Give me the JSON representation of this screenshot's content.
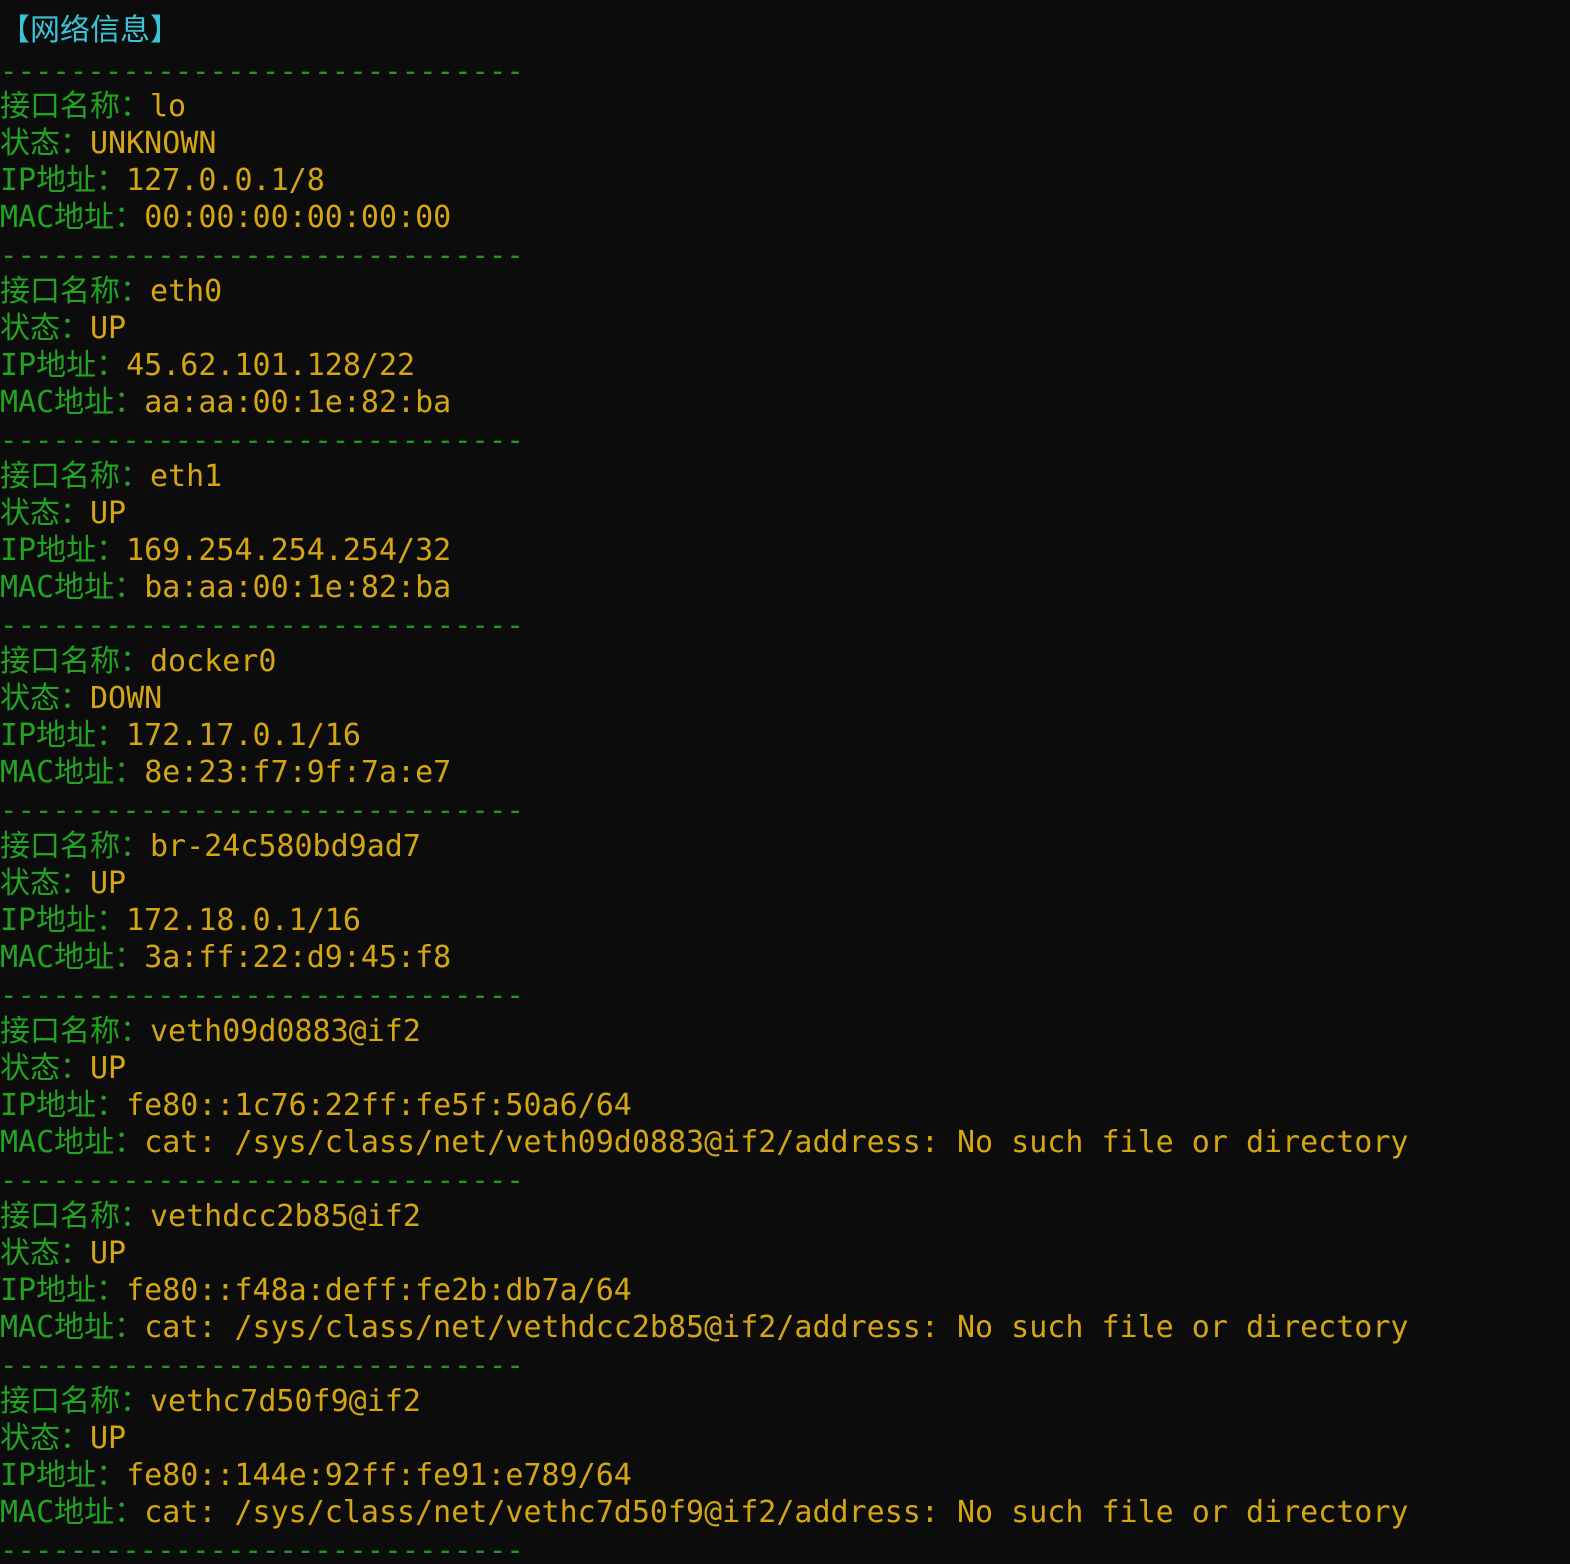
{
  "terminal": {
    "title": "【网络信息】",
    "separator": "------------------------------",
    "colors": {
      "background": "#0c0c0c",
      "title": "#3ac4d6",
      "separator": "#1f9a1f",
      "key": "#22a322",
      "value": "#d4a514"
    },
    "labels": {
      "name": "接口名称：",
      "state": "状态：",
      "ip": "IP地址：",
      "mac": "MAC地址："
    },
    "interfaces": [
      {
        "name": "lo",
        "state": "UNKNOWN",
        "ip": "127.0.0.1/8",
        "mac": "00:00:00:00:00:00"
      },
      {
        "name": "eth0",
        "state": "UP",
        "ip": "45.62.101.128/22",
        "mac": "aa:aa:00:1e:82:ba"
      },
      {
        "name": "eth1",
        "state": "UP",
        "ip": "169.254.254.254/32",
        "mac": "ba:aa:00:1e:82:ba"
      },
      {
        "name": "docker0",
        "state": "DOWN",
        "ip": "172.17.0.1/16",
        "mac": "8e:23:f7:9f:7a:e7"
      },
      {
        "name": "br-24c580bd9ad7",
        "state": "UP",
        "ip": "172.18.0.1/16",
        "mac": "3a:ff:22:d9:45:f8"
      },
      {
        "name": "veth09d0883@if2",
        "state": "UP",
        "ip": "fe80::1c76:22ff:fe5f:50a6/64",
        "mac": "cat: /sys/class/net/veth09d0883@if2/address: No such file or directory"
      },
      {
        "name": "vethdcc2b85@if2",
        "state": "UP",
        "ip": "fe80::f48a:deff:fe2b:db7a/64",
        "mac": "cat: /sys/class/net/vethdcc2b85@if2/address: No such file or directory"
      },
      {
        "name": "vethc7d50f9@if2",
        "state": "UP",
        "ip": "fe80::144e:92ff:fe91:e789/64",
        "mac": "cat: /sys/class/net/vethc7d50f9@if2/address: No such file or directory"
      }
    ]
  }
}
